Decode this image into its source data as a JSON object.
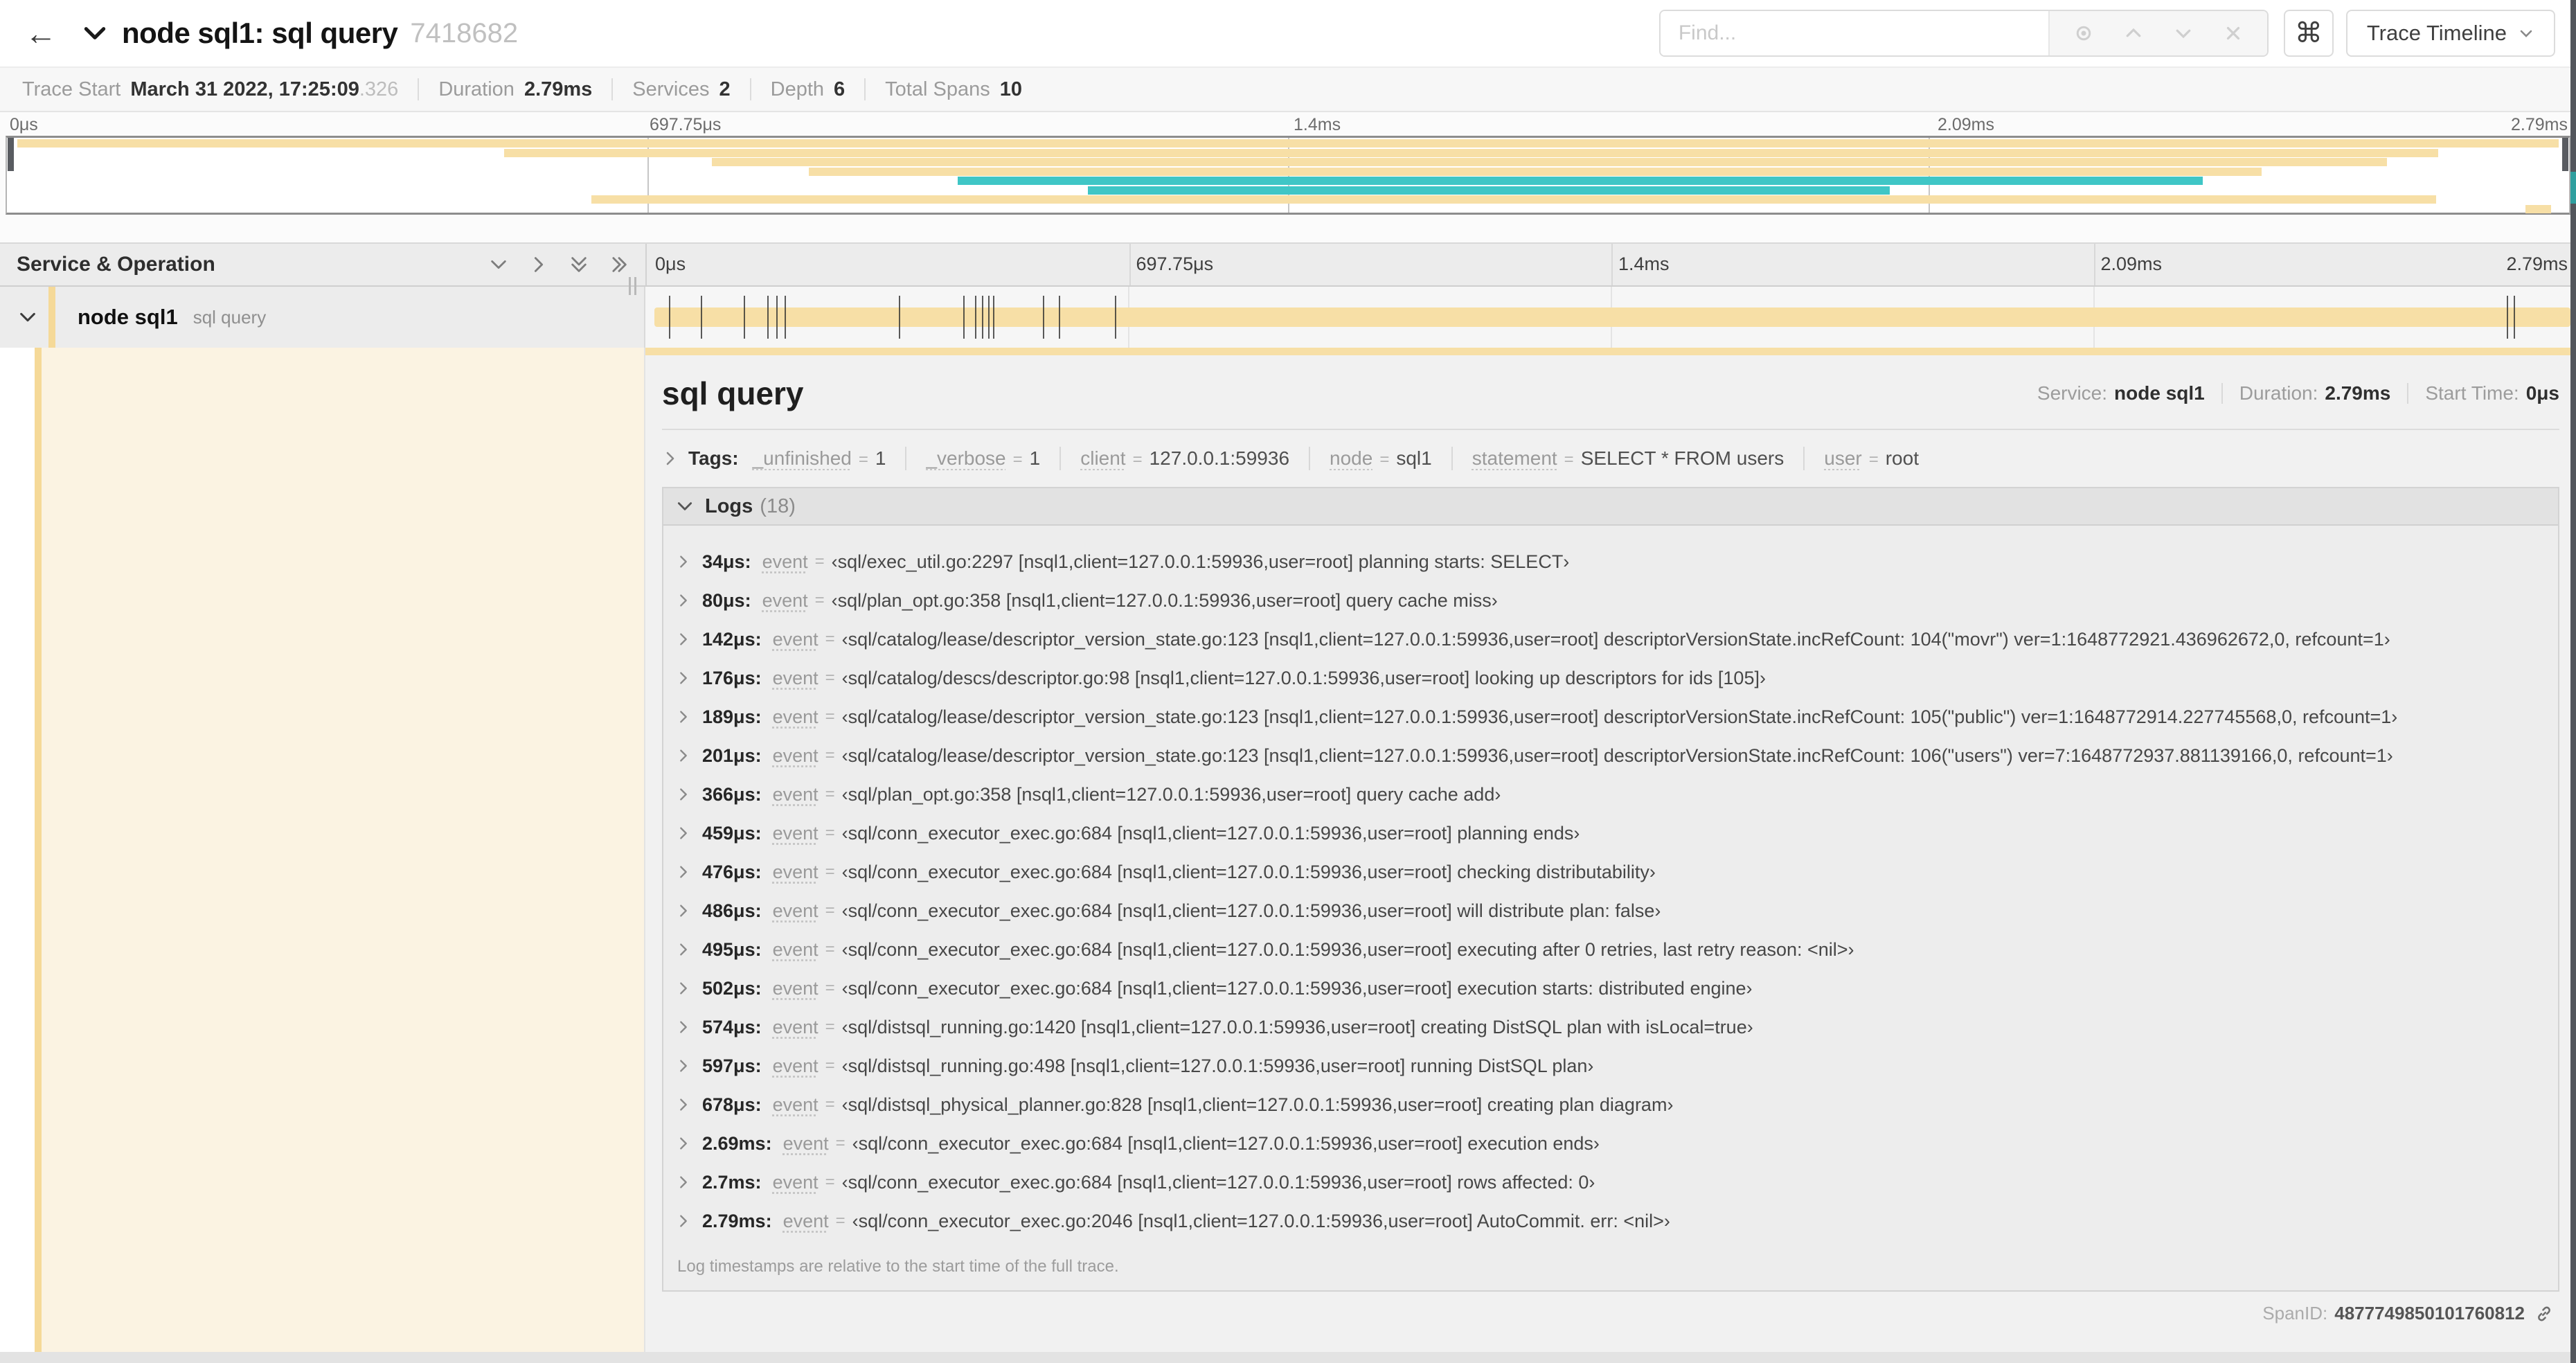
{
  "colors": {
    "tan": "#F7DFA6",
    "teal": "#3FC6C6",
    "stripe": "#F5D998",
    "cream": "#FBF3E2"
  },
  "topnav": {
    "back_symbol": "←",
    "title": "node sql1: sql query",
    "trace_id": "7418682",
    "find": {
      "placeholder": "Find..."
    },
    "cmd_symbol": "⌘",
    "view_selector": "Trace Timeline"
  },
  "trace_stats": {
    "items": [
      {
        "label": "Trace Start",
        "value": "March 31 2022, 17:25:09",
        "suffix": ".326"
      },
      {
        "label": "Duration",
        "value": "2.79ms"
      },
      {
        "label": "Services",
        "value": "2"
      },
      {
        "label": "Depth",
        "value": "6"
      },
      {
        "label": "Total Spans",
        "value": "10"
      }
    ]
  },
  "timeline": {
    "left_header": "Service & Operation",
    "ticks": [
      "0μs",
      "697.75μs",
      "1.4ms",
      "2.09ms",
      "2.79ms"
    ],
    "tick_positions_pct": [
      0,
      25,
      50,
      75,
      100
    ],
    "grid_positions_pct": [
      25,
      50,
      75
    ]
  },
  "minimap": {
    "spans": [
      {
        "l": 0.4,
        "r": 99.6,
        "c": "tan"
      },
      {
        "l": 19.4,
        "r": 94.9,
        "c": "tan"
      },
      {
        "l": 27.5,
        "r": 92.9,
        "c": "tan"
      },
      {
        "l": 31.3,
        "r": 88.0,
        "c": "tan"
      },
      {
        "l": 37.1,
        "r": 85.7,
        "c": "teal"
      },
      {
        "l": 42.2,
        "r": 73.5,
        "c": "teal"
      },
      {
        "l": 22.8,
        "r": 94.8,
        "c": "tan"
      },
      {
        "l": 98.3,
        "r": 99.3,
        "c": "tan"
      }
    ]
  },
  "span_row": {
    "service": "node sql1",
    "operation": "sql query",
    "total_us": 2790,
    "log_ticks_us": [
      34,
      80,
      142,
      176,
      189,
      201,
      366,
      459,
      476,
      486,
      495,
      502,
      574,
      597,
      678,
      2690,
      2700,
      2790
    ]
  },
  "detail": {
    "title": "sql query",
    "meta": [
      {
        "label": "Service:",
        "value": "node sql1"
      },
      {
        "label": "Duration:",
        "value": "2.79ms"
      },
      {
        "label": "Start Time:",
        "value": "0μs"
      }
    ],
    "tags": {
      "label": "Tags:",
      "items": [
        {
          "key": "_unfinished",
          "value": "1"
        },
        {
          "key": "_verbose",
          "value": "1"
        },
        {
          "key": "client",
          "value": "127.0.0.1:59936"
        },
        {
          "key": "node",
          "value": "sql1"
        },
        {
          "key": "statement",
          "value": "SELECT * FROM users"
        },
        {
          "key": "user",
          "value": "root"
        }
      ]
    },
    "logs": {
      "title": "Logs",
      "count": "(18)",
      "key": "event",
      "rows": [
        {
          "time": "34μs:",
          "value": "‹sql/exec_util.go:2297 [nsql1,client=127.0.0.1:59936,user=root] planning starts: SELECT›"
        },
        {
          "time": "80μs:",
          "value": "‹sql/plan_opt.go:358 [nsql1,client=127.0.0.1:59936,user=root] query cache miss›"
        },
        {
          "time": "142μs:",
          "value": "‹sql/catalog/lease/descriptor_version_state.go:123 [nsql1,client=127.0.0.1:59936,user=root] descriptorVersionState.incRefCount: 104(\"movr\") ver=1:1648772921.436962672,0, refcount=1›"
        },
        {
          "time": "176μs:",
          "value": "‹sql/catalog/descs/descriptor.go:98 [nsql1,client=127.0.0.1:59936,user=root] looking up descriptors for ids [105]›"
        },
        {
          "time": "189μs:",
          "value": "‹sql/catalog/lease/descriptor_version_state.go:123 [nsql1,client=127.0.0.1:59936,user=root] descriptorVersionState.incRefCount: 105(\"public\") ver=1:1648772914.227745568,0, refcount=1›"
        },
        {
          "time": "201μs:",
          "value": "‹sql/catalog/lease/descriptor_version_state.go:123 [nsql1,client=127.0.0.1:59936,user=root] descriptorVersionState.incRefCount: 106(\"users\") ver=7:1648772937.881139166,0, refcount=1›"
        },
        {
          "time": "366μs:",
          "value": "‹sql/plan_opt.go:358 [nsql1,client=127.0.0.1:59936,user=root] query cache add›"
        },
        {
          "time": "459μs:",
          "value": "‹sql/conn_executor_exec.go:684 [nsql1,client=127.0.0.1:59936,user=root] planning ends›"
        },
        {
          "time": "476μs:",
          "value": "‹sql/conn_executor_exec.go:684 [nsql1,client=127.0.0.1:59936,user=root] checking distributability›"
        },
        {
          "time": "486μs:",
          "value": "‹sql/conn_executor_exec.go:684 [nsql1,client=127.0.0.1:59936,user=root] will distribute plan: false›"
        },
        {
          "time": "495μs:",
          "value": "‹sql/conn_executor_exec.go:684 [nsql1,client=127.0.0.1:59936,user=root] executing after 0 retries, last retry reason: <nil>›"
        },
        {
          "time": "502μs:",
          "value": "‹sql/conn_executor_exec.go:684 [nsql1,client=127.0.0.1:59936,user=root] execution starts: distributed engine›"
        },
        {
          "time": "574μs:",
          "value": "‹sql/distsql_running.go:1420 [nsql1,client=127.0.0.1:59936,user=root] creating DistSQL plan with isLocal=true›"
        },
        {
          "time": "597μs:",
          "value": "‹sql/distsql_running.go:498 [nsql1,client=127.0.0.1:59936,user=root] running DistSQL plan›"
        },
        {
          "time": "678μs:",
          "value": "‹sql/distsql_physical_planner.go:828 [nsql1,client=127.0.0.1:59936,user=root] creating plan diagram›"
        },
        {
          "time": "2.69ms:",
          "value": "‹sql/conn_executor_exec.go:684 [nsql1,client=127.0.0.1:59936,user=root] execution ends›"
        },
        {
          "time": "2.7ms:",
          "value": "‹sql/conn_executor_exec.go:684 [nsql1,client=127.0.0.1:59936,user=root] rows affected: 0›"
        },
        {
          "time": "2.79ms:",
          "value": "‹sql/conn_executor_exec.go:2046 [nsql1,client=127.0.0.1:59936,user=root] AutoCommit. err: <nil>›"
        }
      ],
      "footnote": "Log timestamps are relative to the start time of the full trace."
    },
    "span_id": {
      "label": "SpanID:",
      "value": "4877749850101760812"
    }
  }
}
